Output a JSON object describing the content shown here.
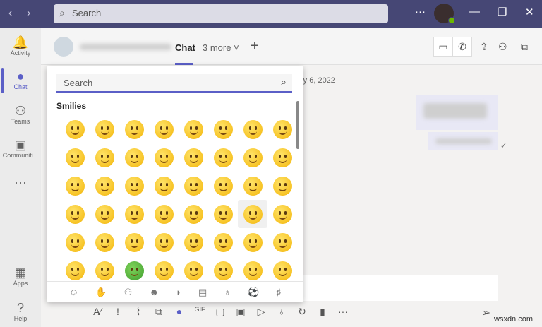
{
  "titlebar": {
    "search_placeholder": "Search",
    "more": "···",
    "minimize": "—",
    "maximize": "❐",
    "close": "✕",
    "back": "‹",
    "forward": "›"
  },
  "rail": [
    {
      "label": "Activity",
      "icon": "bell-icon",
      "glyph": "🔔"
    },
    {
      "label": "Chat",
      "icon": "chat-icon",
      "glyph": "●"
    },
    {
      "label": "Teams",
      "icon": "teams-icon",
      "glyph": "⚇"
    },
    {
      "label": "Communiti...",
      "icon": "communities-icon",
      "glyph": "▣"
    },
    {
      "label": "",
      "icon": "more-icon",
      "glyph": "···"
    },
    {
      "label": "Apps",
      "icon": "apps-icon",
      "glyph": "▦"
    },
    {
      "label": "Help",
      "icon": "help-icon",
      "glyph": "?"
    }
  ],
  "header": {
    "tab_chat": "Chat",
    "tab_more": "3 more ˅",
    "add": "+"
  },
  "chat": {
    "date": "ry 6, 2022"
  },
  "picker": {
    "search_placeholder": "Search",
    "category": "Smilies",
    "emoji_count": 48,
    "green_index": 42,
    "selected_index": 30,
    "categories": [
      "smiley-icon",
      "hand-icon",
      "people-icon",
      "animal-icon",
      "food-icon",
      "travel-icon",
      "lightbulb-icon",
      "ball-icon",
      "symbol-icon"
    ],
    "category_glyphs": [
      "☺",
      "✋",
      "⚇",
      "☻",
      "◗",
      "▤",
      "♁",
      "⚽",
      "♯"
    ]
  },
  "toolbar": {
    "glyphs": [
      "A⁄",
      "!",
      "⌇",
      "⧉",
      "●",
      "GIF",
      "▢",
      "▣",
      "▷",
      "♁",
      "↻",
      "▮",
      "···"
    ],
    "names": [
      "format-icon",
      "important-icon",
      "attach-icon",
      "loop-icon",
      "emoji-icon",
      "gif-icon",
      "sticker-icon",
      "schedule-icon",
      "stream-icon",
      "praise-icon",
      "updates-icon",
      "apps-icon",
      "more-icon"
    ],
    "send": "➢"
  },
  "watermark": "wsxdn.com"
}
